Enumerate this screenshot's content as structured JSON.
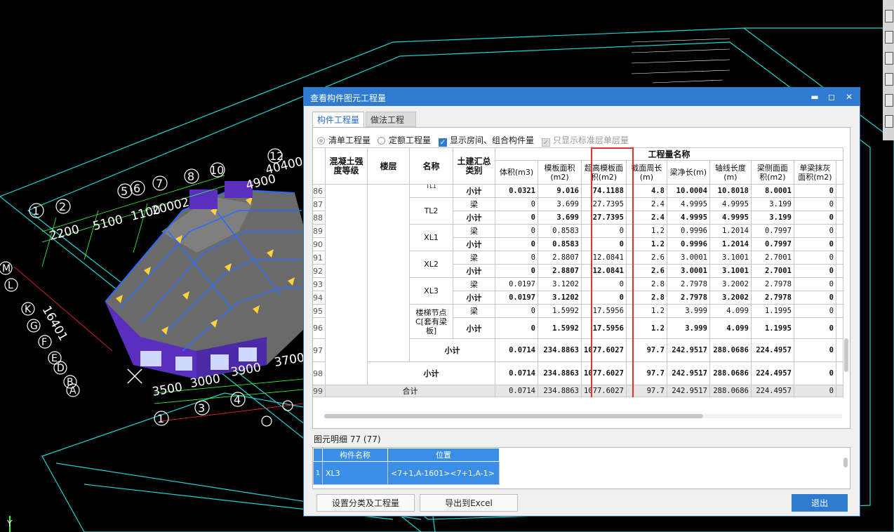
{
  "cad": {
    "axis_numbers_top": [
      "1",
      "2",
      "3",
      "4",
      "5",
      "6",
      "7",
      "8",
      "10",
      "12"
    ],
    "axis_letters_left": [
      "M",
      "L",
      "K",
      "G",
      "F",
      "E",
      "D",
      "B",
      "A"
    ],
    "dims": [
      "2200",
      "5100",
      "1100",
      "20002",
      "4900",
      "40400",
      "3500",
      "3000",
      "3900",
      "3700",
      "16401"
    ],
    "bottom_numbers": [
      "1",
      "2",
      "3",
      "4",
      "5"
    ],
    "axis_glyph": "Y"
  },
  "window": {
    "title": "查看构件图元工程量",
    "controls": {
      "minimize": "▬",
      "maximize": "◻",
      "close": "✕"
    }
  },
  "tabs": [
    "构件工程量",
    "做法工程量"
  ],
  "options": {
    "radio_list": "清单工程量",
    "radio_quota": "定额工程量",
    "chk_rooms": "显示房间、组合构件量",
    "chk_std": "只显示标准层单层量"
  },
  "table": {
    "headers": {
      "grade": "混凝土强度等级",
      "floor": "楼层",
      "name": "名称",
      "category": "土建汇总类别",
      "group": "工程量名称",
      "cols": [
        "体积(m3)",
        "模板面积(m2)",
        "超高模板面积(m2)",
        "截面周长(m)",
        "梁净长(m)",
        "轴线长度(m)",
        "梁侧面面积(m2)",
        "单梁抹灰面积(m2)"
      ]
    },
    "rows": [
      {
        "no": "86",
        "name": "TL1",
        "type": "小计",
        "bold": true,
        "vals": [
          "0.0321",
          "9.016",
          "74.1188",
          "4.8",
          "10.0004",
          "10.8018",
          "8.0001",
          "0"
        ]
      },
      {
        "no": "87",
        "name": "TL2",
        "type": "梁",
        "bold": false,
        "vals": [
          "0",
          "3.699",
          "27.7395",
          "2.4",
          "4.9995",
          "4.9995",
          "3.199",
          "0"
        ]
      },
      {
        "no": "88",
        "name": "",
        "type": "小计",
        "bold": true,
        "vals": [
          "0",
          "3.699",
          "27.7395",
          "2.4",
          "4.9995",
          "4.9995",
          "3.199",
          "0"
        ]
      },
      {
        "no": "89",
        "name": "XL1",
        "type": "梁",
        "bold": false,
        "vals": [
          "0",
          "0.8583",
          "0",
          "1.2",
          "0.9996",
          "1.2014",
          "0.7997",
          "0"
        ]
      },
      {
        "no": "90",
        "name": "",
        "type": "小计",
        "bold": true,
        "vals": [
          "0",
          "0.8583",
          "0",
          "1.2",
          "0.9996",
          "1.2014",
          "0.7997",
          "0"
        ]
      },
      {
        "no": "91",
        "name": "XL2",
        "type": "梁",
        "bold": false,
        "vals": [
          "0",
          "2.8807",
          "12.0841",
          "2.6",
          "3.0001",
          "3.1001",
          "2.7001",
          "0"
        ]
      },
      {
        "no": "92",
        "name": "",
        "type": "小计",
        "bold": true,
        "vals": [
          "0",
          "2.8807",
          "12.0841",
          "2.6",
          "3.0001",
          "3.1001",
          "2.7001",
          "0"
        ]
      },
      {
        "no": "93",
        "name": "XL3",
        "type": "梁",
        "bold": false,
        "vals": [
          "0.0197",
          "3.1202",
          "0",
          "2.8",
          "2.7978",
          "3.2002",
          "2.7978",
          "0"
        ]
      },
      {
        "no": "94",
        "name": "",
        "type": "小计",
        "bold": true,
        "vals": [
          "0.0197",
          "3.1202",
          "0",
          "2.8",
          "2.7978",
          "3.2002",
          "2.7978",
          "0"
        ]
      },
      {
        "no": "95",
        "name": "楼梯节点C[套有梁板]",
        "type": "梁",
        "bold": false,
        "vals": [
          "0",
          "1.5992",
          "17.5956",
          "1.2",
          "3.999",
          "4.099",
          "1.1995",
          "0"
        ]
      },
      {
        "no": "96",
        "name": "",
        "type": "小计",
        "bold": true,
        "vals": [
          "0",
          "1.5992",
          "17.5956",
          "1.2",
          "3.999",
          "4.099",
          "1.1995",
          "0"
        ]
      }
    ],
    "subtotal_name": {
      "no": "97",
      "label": "小计",
      "vals": [
        "0.0714",
        "234.8863",
        "1077.6027",
        "97.7",
        "242.9517",
        "288.0686",
        "224.4957",
        "0"
      ]
    },
    "subtotal_floor": {
      "no": "98",
      "label": "小计",
      "vals": [
        "0.0714",
        "234.8863",
        "1077.6027",
        "97.7",
        "242.9517",
        "288.0686",
        "224.4957",
        "0"
      ]
    },
    "total": {
      "no": "99",
      "label": "合计",
      "vals": [
        "0.0714",
        "234.8863",
        "1077.6027",
        "97.7",
        "242.9517",
        "288.0686",
        "224.4957",
        "0"
      ]
    }
  },
  "detail": {
    "label": "图元明细  77 (77)",
    "headers": [
      "构件名称",
      "位置"
    ],
    "rows": [
      {
        "no": "1",
        "name": "XL3",
        "pos": "<7+1,A-1601><7+1,A-1>"
      }
    ]
  },
  "buttons": {
    "settings": "设置分类及工程量",
    "export": "导出到Excel",
    "exit": "退出"
  },
  "colors": {
    "accent": "#2e7bd1",
    "highlight_box": "#e53030",
    "cad_bg": "#000000"
  }
}
